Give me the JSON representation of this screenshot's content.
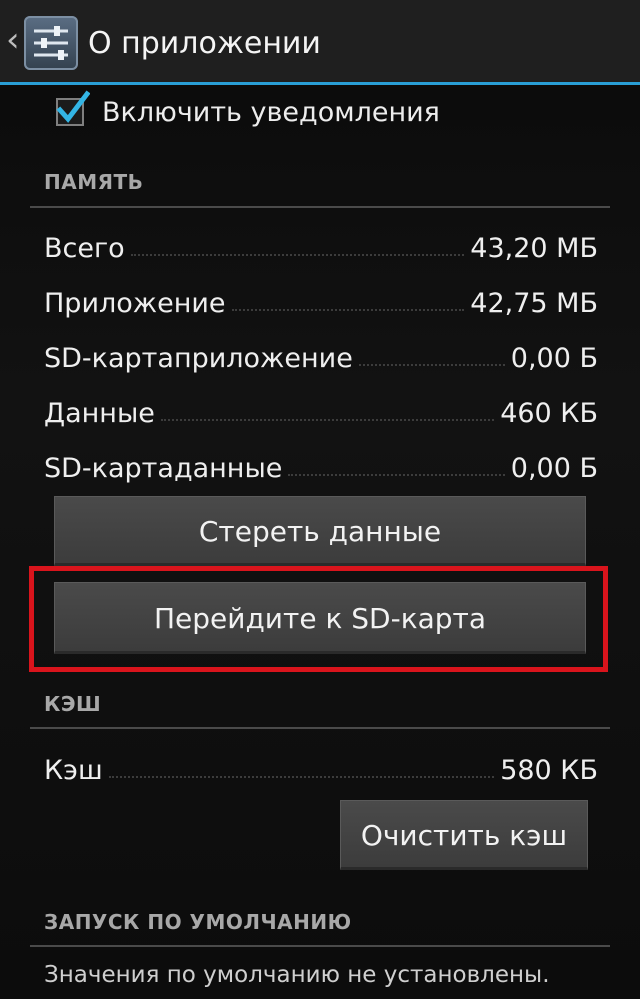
{
  "action_bar": {
    "title": "О приложении",
    "up_icon": "chevron-left-icon",
    "app_icon": "settings-sliders-icon"
  },
  "notifications": {
    "label": "Включить уведомления",
    "checked": true
  },
  "storage": {
    "header": "ПАМЯТЬ",
    "rows": [
      {
        "label": "Всего",
        "value": "43,20 МБ"
      },
      {
        "label": "Приложение",
        "value": "42,75 МБ"
      },
      {
        "label": "SD-картаприложение",
        "value": "0,00 Б"
      },
      {
        "label": "Данные",
        "value": "460 КБ"
      },
      {
        "label": "SD-картаданные",
        "value": "0,00 Б"
      }
    ],
    "clear_data_label": "Стереть данные",
    "move_to_sd_label": "Перейдите к SD-карта"
  },
  "cache": {
    "header": "КЭШ",
    "row": {
      "label": "Кэш",
      "value": "580 КБ"
    },
    "clear_cache_label": "Очистить кэш"
  },
  "launch_default": {
    "header": "ЗАПУСК ПО УМОЛЧАНИЮ",
    "info": "Значения по умолчанию не установлены."
  },
  "colors": {
    "accent": "#2a9fd6",
    "highlight": "#d9141c",
    "background": "#0c0c0c"
  }
}
